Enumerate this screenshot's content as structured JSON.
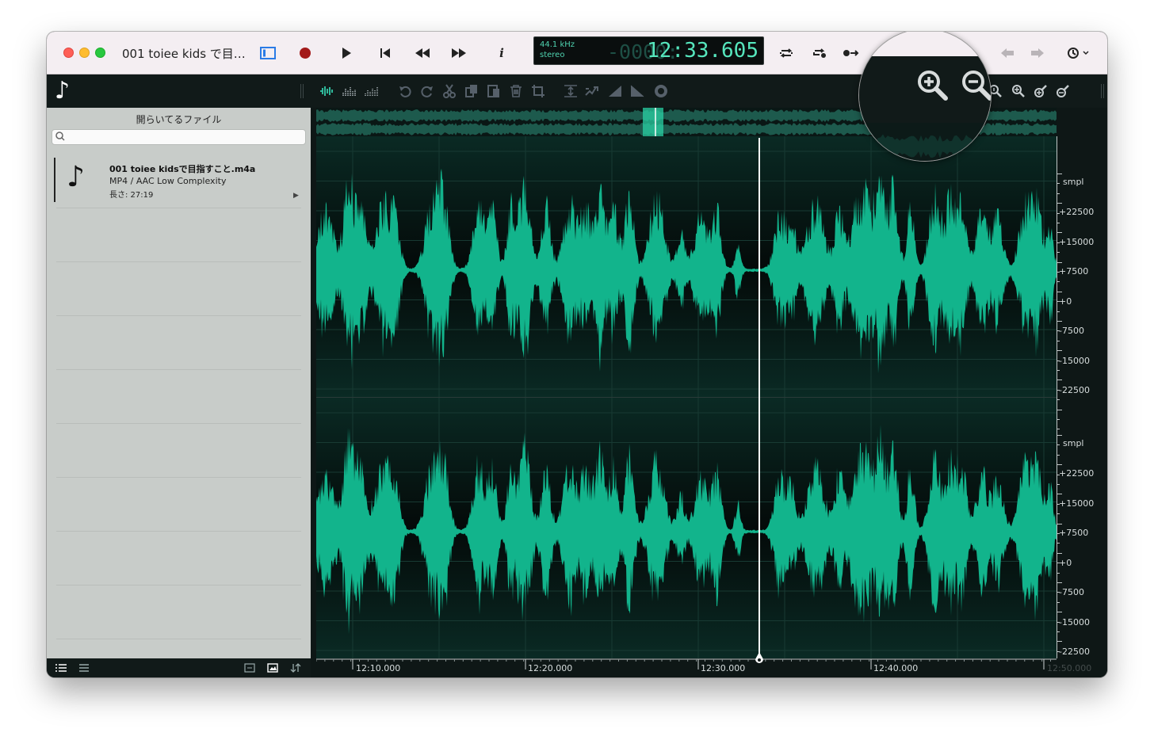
{
  "window": {
    "title": "001 toiee kids で目…"
  },
  "lcd": {
    "rate": "44.1 kHz",
    "channels": "stereo",
    "ghost": "-0000:",
    "time": "12:33.605"
  },
  "sidebar": {
    "title": "開らいてるファイル",
    "search_placeholder": "",
    "files": [
      {
        "name": "001 toiee kidsで目指すこと.m4a",
        "format": "MP4 / AAC Low Complexity",
        "length": "長さ: 27:19"
      }
    ]
  },
  "scale": {
    "unit": "smpl",
    "labels": [
      "+22500",
      "+15000",
      "+7500",
      "+0",
      "-7500",
      "-15000",
      "-22500"
    ]
  },
  "ruler": {
    "labels": [
      "12:10.000",
      "12:20.000",
      "12:30.000",
      "12:40.000",
      "12:50.000"
    ]
  },
  "colors": {
    "waveform": "#12b48c",
    "playhead": "#ffffff",
    "lcd_text": "#56e6bd"
  },
  "icons": {
    "titlebar": [
      "sidebar-toggle-icon",
      "record-icon",
      "play-icon",
      "skip-to-start-icon",
      "rewind-icon",
      "fast-forward-icon",
      "info-icon",
      "loop-icon",
      "loop-selection-icon",
      "follow-playhead-icon",
      "back-arrow-icon",
      "forward-arrow-icon",
      "history-icon"
    ],
    "toolbar": [
      "waveform-view-icon",
      "spectrum-view-icon",
      "spectrogram-view-icon",
      "undo-icon",
      "redo-icon",
      "cut-icon",
      "copy-icon",
      "paste-icon",
      "delete-icon",
      "crop-icon",
      "normalize-icon",
      "reverse-icon",
      "fade-in-icon",
      "fade-out-icon",
      "record-effect-icon",
      "zoom-in-icon",
      "zoom-out-icon",
      "zoom-in-small-icon",
      "zoom-fit-icon",
      "zoom-selection-icon"
    ]
  }
}
